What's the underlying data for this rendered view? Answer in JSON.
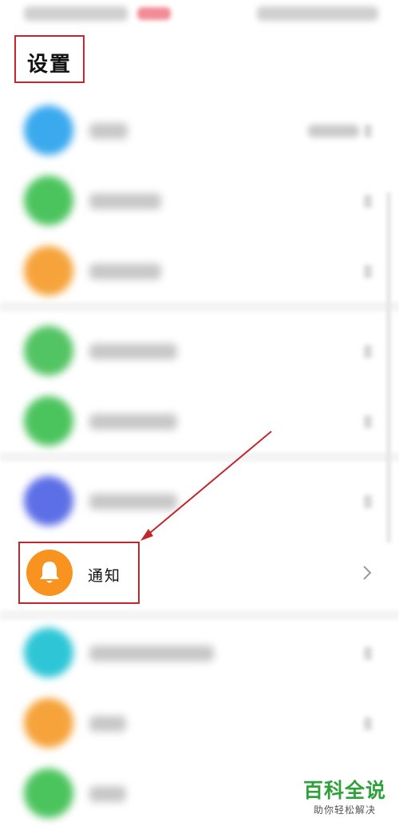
{
  "header": {
    "title": "设置"
  },
  "settings_rows": [
    {
      "icon": "blurred-blue-icon",
      "color": "#3aa9ee",
      "label_width": 48,
      "has_value": true,
      "top": 0
    },
    {
      "icon": "blurred-green-icon",
      "color": "#4cc45e",
      "label_width": 90,
      "has_value": false
    },
    {
      "icon": "blurred-orange-icon",
      "color": "#f6a33b",
      "label_width": 90,
      "has_value": false
    },
    {
      "icon": "blurred-green-icon",
      "color": "#53c463",
      "label_width": 110,
      "has_value": false
    },
    {
      "icon": "blurred-green-icon",
      "color": "#4cc45e",
      "label_width": 110,
      "has_value": false
    },
    {
      "icon": "blurred-indigo-icon",
      "color": "#5d6fe6",
      "label_width": 110,
      "has_value": false
    }
  ],
  "notification": {
    "label": "通知",
    "icon": "bell-icon",
    "icon_color": "#f7931e"
  },
  "lower_rows": [
    {
      "icon": "blurred-teal-icon",
      "color": "#2ec6d6",
      "label_width": 156
    },
    {
      "icon": "blurred-orange-icon",
      "color": "#f6a33b",
      "label_width": 46
    },
    {
      "icon": "blurred-green-icon",
      "color": "#4cc45e",
      "label_width": 46
    }
  ],
  "annotation": {
    "highlight_color": "#c0282d",
    "arrow_color": "#c0282d"
  },
  "watermark": {
    "title": "百科全说",
    "subtitle": "助你轻松解决",
    "color": "#2fa13a"
  }
}
